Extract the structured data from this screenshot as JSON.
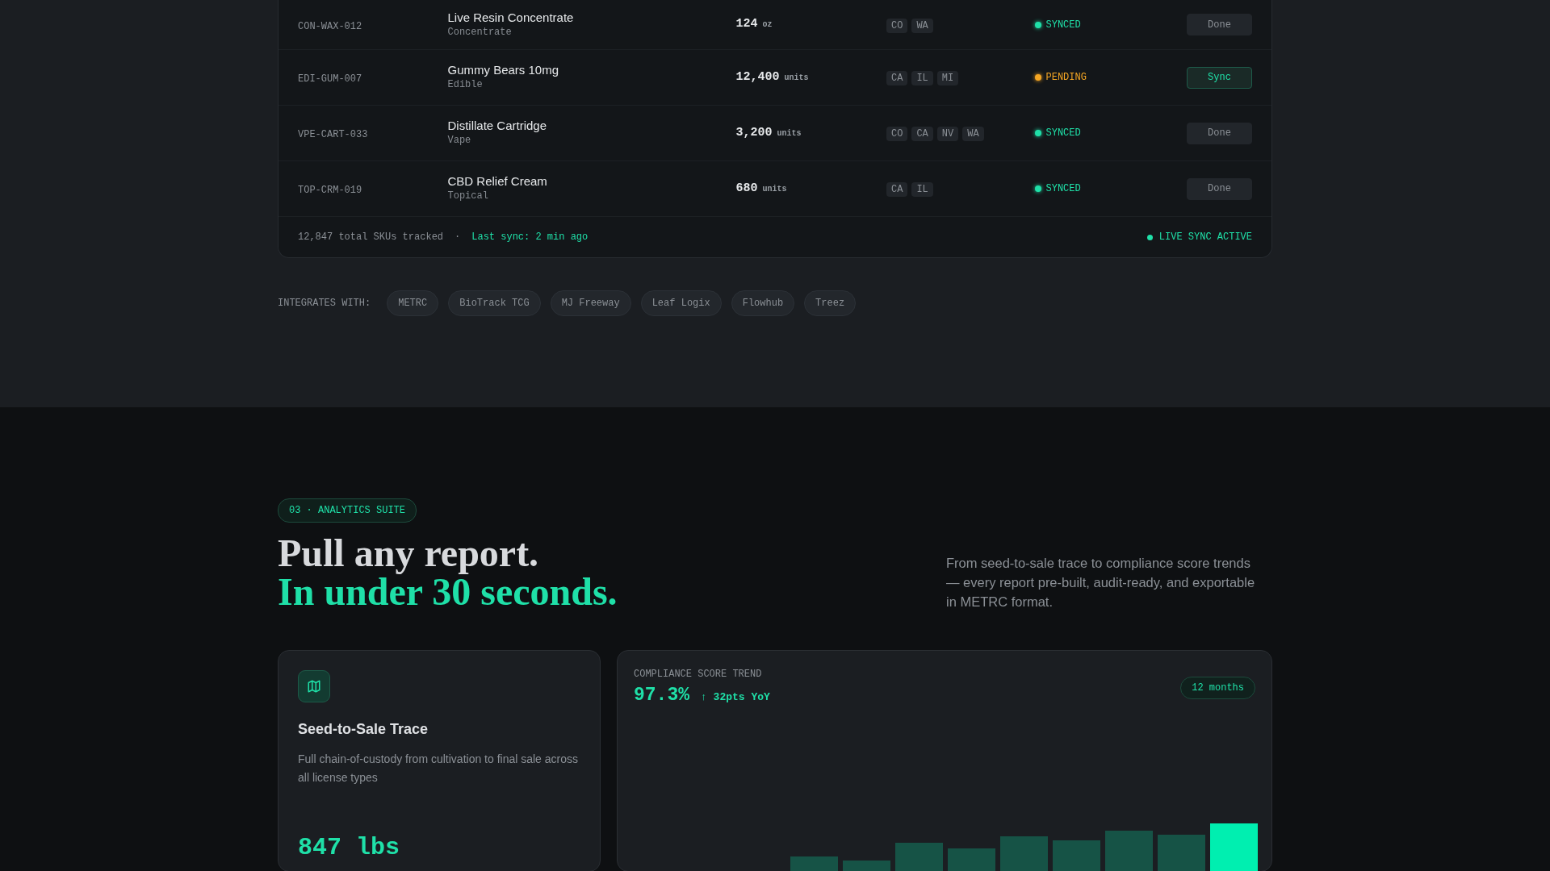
{
  "inventory": {
    "rows": [
      {
        "sku": "CON-WAX-012",
        "name": "Live Resin Concentrate",
        "category": "Concentrate",
        "qty": "124",
        "unit": "oz",
        "states": [
          "CO",
          "WA"
        ],
        "status": {
          "kind": "synced",
          "label": "SYNCED"
        },
        "action": {
          "kind": "done",
          "label": "Done"
        }
      },
      {
        "sku": "EDI-GUM-007",
        "name": "Gummy Bears 10mg",
        "category": "Edible",
        "qty": "12,400",
        "unit": "units",
        "states": [
          "CA",
          "IL",
          "MI"
        ],
        "status": {
          "kind": "pending",
          "label": "PENDING"
        },
        "action": {
          "kind": "sync",
          "label": "Sync"
        }
      },
      {
        "sku": "VPE-CART-033",
        "name": "Distillate Cartridge",
        "category": "Vape",
        "qty": "3,200",
        "unit": "units",
        "states": [
          "CO",
          "CA",
          "NV",
          "WA"
        ],
        "status": {
          "kind": "synced",
          "label": "SYNCED"
        },
        "action": {
          "kind": "done",
          "label": "Done"
        }
      },
      {
        "sku": "TOP-CRM-019",
        "name": "CBD Relief Cream",
        "category": "Topical",
        "qty": "680",
        "unit": "units",
        "states": [
          "CA",
          "IL"
        ],
        "status": {
          "kind": "synced",
          "label": "SYNCED"
        },
        "action": {
          "kind": "done",
          "label": "Done"
        }
      }
    ],
    "footer": {
      "total": "12,847 total SKUs tracked",
      "separator": "·",
      "last_sync": "Last sync: 2 min ago",
      "live": "LIVE SYNC ACTIVE"
    }
  },
  "integrations": {
    "label": "INTEGRATES WITH:",
    "items": [
      "METRC",
      "BioTrack TCG",
      "MJ Freeway",
      "Leaf Logix",
      "Flowhub",
      "Treez"
    ]
  },
  "analytics": {
    "badge": "03 · ANALYTICS SUITE",
    "title_line1": "Pull any report.",
    "title_line2": "In under 30 seconds.",
    "description": "From seed-to-sale trace to compliance score trends — every report pre-built, audit-ready, and exportable in METRC format.",
    "trace_card": {
      "title": "Seed-to-Sale Trace",
      "description": "Full chain-of-custody from cultivation to final sale across all license types",
      "metric": "847 lbs"
    },
    "compliance_card": {
      "label": "COMPLIANCE SCORE TREND",
      "score": "97.3%",
      "change": "↑ 32pts YoY",
      "range": "12 months"
    }
  }
}
